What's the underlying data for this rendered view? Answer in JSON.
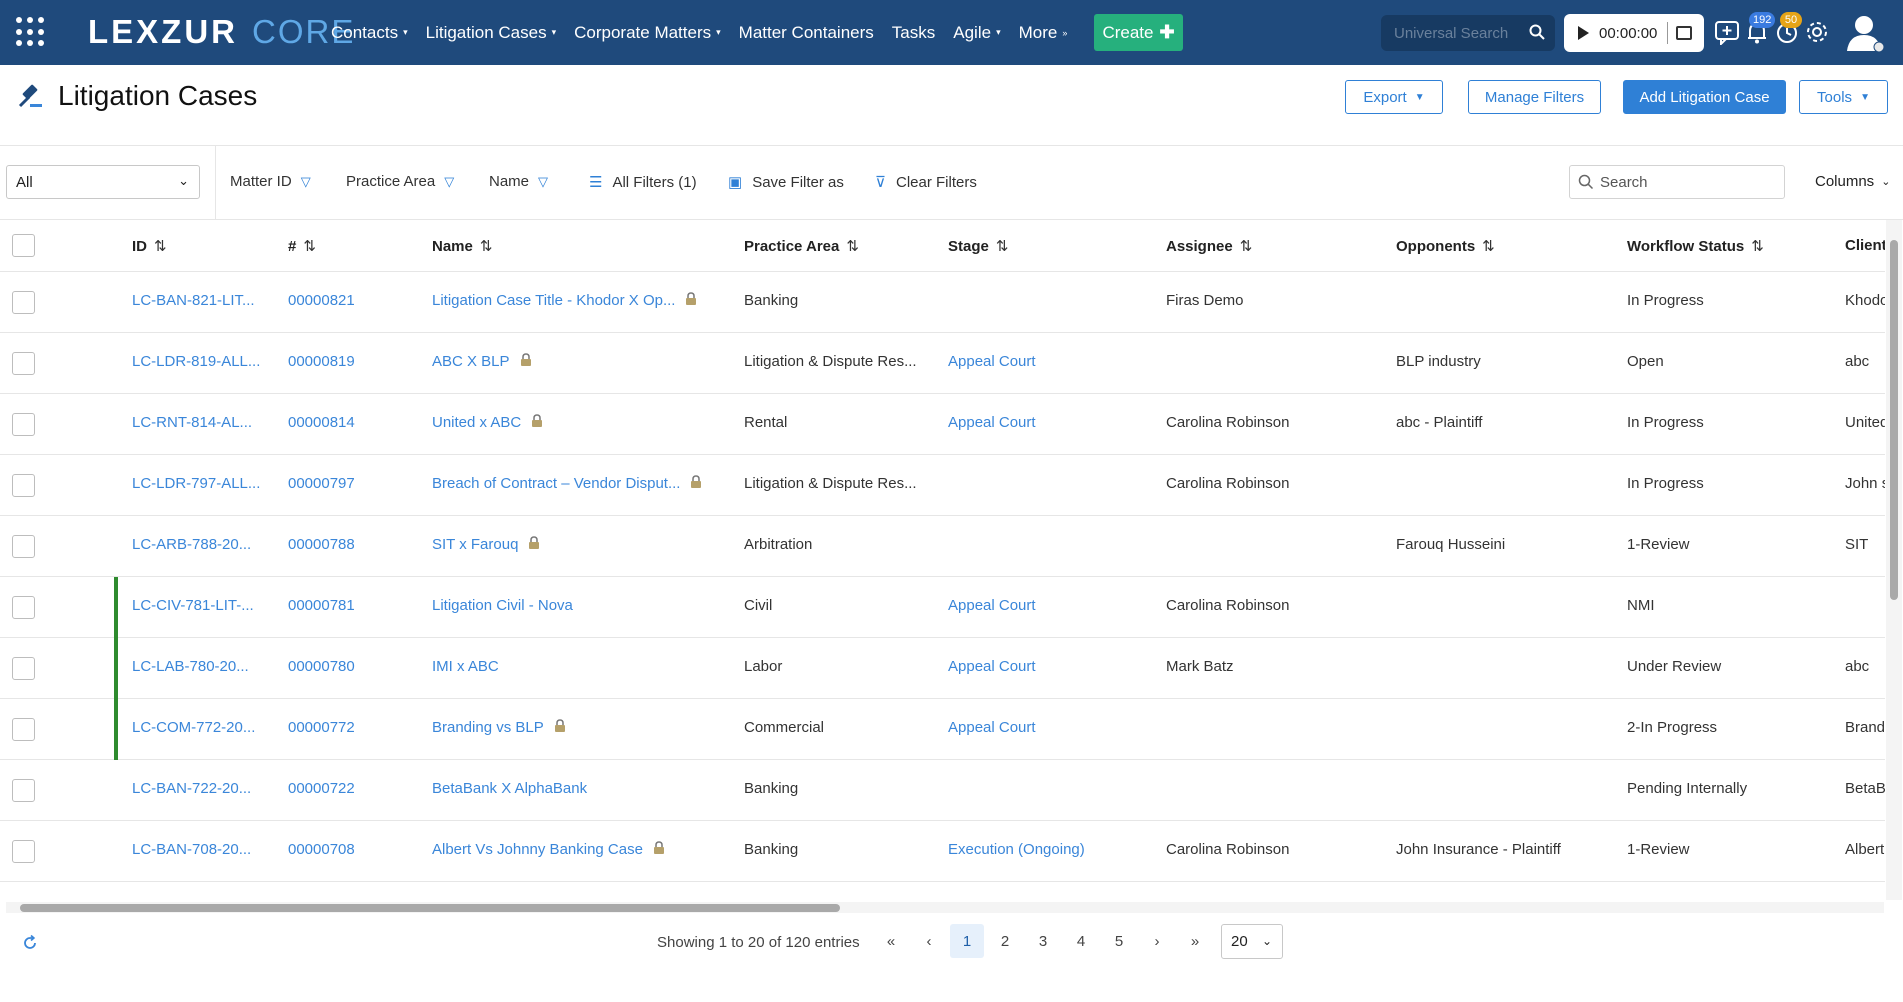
{
  "app": {
    "logo_main": "LEXZUR",
    "logo_sub": "CORE"
  },
  "nav": {
    "items": [
      {
        "label": "Contacts",
        "caret": "▾"
      },
      {
        "label": "Litigation Cases",
        "caret": "▾"
      },
      {
        "label": "Corporate Matters",
        "caret": "▾"
      },
      {
        "label": "Matter Containers",
        "caret": ""
      },
      {
        "label": "Tasks",
        "caret": ""
      },
      {
        "label": "Agile",
        "caret": "▾"
      },
      {
        "label": "More",
        "caret": "»"
      }
    ],
    "create_label": "Create",
    "search_placeholder": "Universal Search",
    "timer": "00:00:00",
    "notif_badge": "192",
    "reminder_badge": "50"
  },
  "page": {
    "title": "Litigation Cases",
    "export_label": "Export",
    "manage_filters_label": "Manage Filters",
    "add_label": "Add Litigation Case",
    "tools_label": "Tools"
  },
  "filters": {
    "scope_value": "All",
    "matter_id": "Matter ID",
    "practice_area": "Practice Area",
    "name": "Name",
    "all_filters": "All Filters (1)",
    "save_filter": "Save Filter as",
    "clear_filters": "Clear Filters",
    "search_placeholder": "Search",
    "columns_label": "Columns"
  },
  "table": {
    "headers": [
      "ID",
      "#",
      "Name",
      "Practice Area",
      "Stage",
      "Assignee",
      "Opponents",
      "Workflow Status",
      "Client I"
    ],
    "sort_icon": "⇅",
    "rows": [
      {
        "id": "LC-BAN-821-LIT...",
        "num": "00000821",
        "name": "Litigation Case Title - Khodor X Op...",
        "lock": true,
        "area": "Banking",
        "stage": "",
        "assignee": "Firas Demo",
        "opponents": "",
        "status": "In Progress",
        "client": "Khodo",
        "mark": false
      },
      {
        "id": "LC-LDR-819-ALL...",
        "num": "00000819",
        "name": "ABC X BLP",
        "lock": true,
        "area": "Litigation & Dispute Res...",
        "stage": "Appeal Court",
        "assignee": "",
        "opponents": "BLP industry",
        "status": "Open",
        "client": "abc",
        "mark": false
      },
      {
        "id": "LC-RNT-814-AL...",
        "num": "00000814",
        "name": "United x ABC",
        "lock": true,
        "area": "Rental",
        "stage": "Appeal Court",
        "assignee": "Carolina Robinson",
        "opponents": "abc - Plaintiff",
        "status": "In Progress",
        "client": "United",
        "mark": false
      },
      {
        "id": "LC-LDR-797-ALL...",
        "num": "00000797",
        "name": "Breach of Contract – Vendor Disput...",
        "lock": true,
        "area": "Litigation & Dispute Res...",
        "stage": "",
        "assignee": "Carolina Robinson",
        "opponents": "",
        "status": "In Progress",
        "client": "John s",
        "mark": false
      },
      {
        "id": "LC-ARB-788-20...",
        "num": "00000788",
        "name": "SIT x Farouq",
        "lock": true,
        "area": "Arbitration",
        "stage": "",
        "assignee": "",
        "opponents": "Farouq Husseini",
        "status": "1-Review",
        "client": "SIT",
        "mark": false
      },
      {
        "id": "LC-CIV-781-LIT-...",
        "num": "00000781",
        "name": "Litigation Civil - Nova",
        "lock": false,
        "area": "Civil",
        "stage": "Appeal Court",
        "assignee": "Carolina Robinson",
        "opponents": "",
        "status": "NMI",
        "client": "",
        "mark": true
      },
      {
        "id": "LC-LAB-780-20...",
        "num": "00000780",
        "name": "IMI x ABC",
        "lock": false,
        "area": "Labor",
        "stage": "Appeal Court",
        "assignee": "Mark Batz",
        "opponents": "",
        "status": "Under Review",
        "client": "abc",
        "mark": true
      },
      {
        "id": "LC-COM-772-20...",
        "num": "00000772",
        "name": "Branding vs BLP",
        "lock": true,
        "area": "Commercial",
        "stage": "Appeal Court",
        "assignee": "",
        "opponents": "",
        "status": "2-In Progress",
        "client": "Brandi",
        "mark": true
      },
      {
        "id": "LC-BAN-722-20...",
        "num": "00000722",
        "name": "BetaBank X AlphaBank",
        "lock": false,
        "area": "Banking",
        "stage": "",
        "assignee": "",
        "opponents": "",
        "status": "Pending Internally",
        "client": "BetaBa",
        "mark": false
      },
      {
        "id": "LC-BAN-708-20...",
        "num": "00000708",
        "name": "Albert Vs Johnny Banking Case",
        "lock": true,
        "area": "Banking",
        "stage": "Execution (Ongoing)",
        "assignee": "Carolina Robinson",
        "opponents": "John Insurance - Plaintiff",
        "status": "1-Review",
        "client": "Albert",
        "mark": false
      }
    ]
  },
  "footer": {
    "showing": "Showing 1 to 20 of 120 entries",
    "first": "«",
    "prev": "‹",
    "pages": [
      "1",
      "2",
      "3",
      "4",
      "5"
    ],
    "next": "›",
    "last": "»",
    "page_size": "20"
  },
  "colors": {
    "nav_bg": "#1f4a7c",
    "accent": "#2f80d6",
    "create": "#26b07d",
    "row_mark": "#2e8b2e"
  },
  "icons": [
    "apps-grid-icon",
    "search-icon",
    "play-icon",
    "note-icon",
    "chat-plus-icon",
    "bell-icon",
    "reminder-icon",
    "gear-icon",
    "user-avatar-icon",
    "gavel-icon",
    "filter-funnel-icon",
    "sliders-icon",
    "save-icon",
    "clear-filter-icon",
    "lock-icon",
    "refresh-icon"
  ]
}
